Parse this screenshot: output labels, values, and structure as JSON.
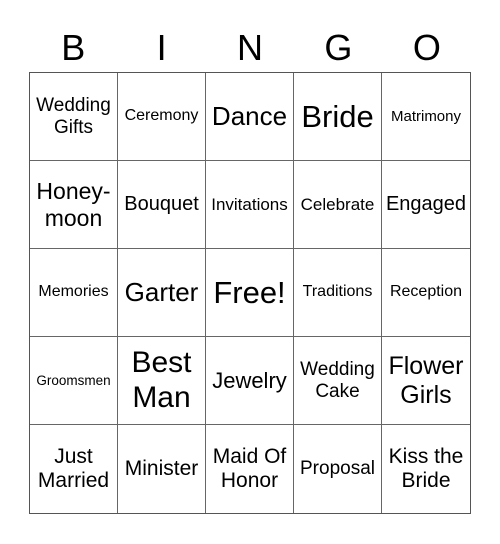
{
  "header": {
    "letters": [
      "B",
      "I",
      "N",
      "G",
      "O"
    ]
  },
  "cells": [
    "Wedding Gifts",
    "Ceremony",
    "Dance",
    "Bride",
    "Matrimony",
    "Honey-moon",
    "Bouquet",
    "Invitations",
    "Celebrate",
    "Engaged",
    "Memories",
    "Garter",
    "Free!",
    "Traditions",
    "Reception",
    "Groomsmen",
    "Best Man",
    "Jewelry",
    "Wedding Cake",
    "Flower Girls",
    "Just Married",
    "Minister",
    "Maid Of Honor",
    "Proposal",
    "Kiss the Bride"
  ]
}
